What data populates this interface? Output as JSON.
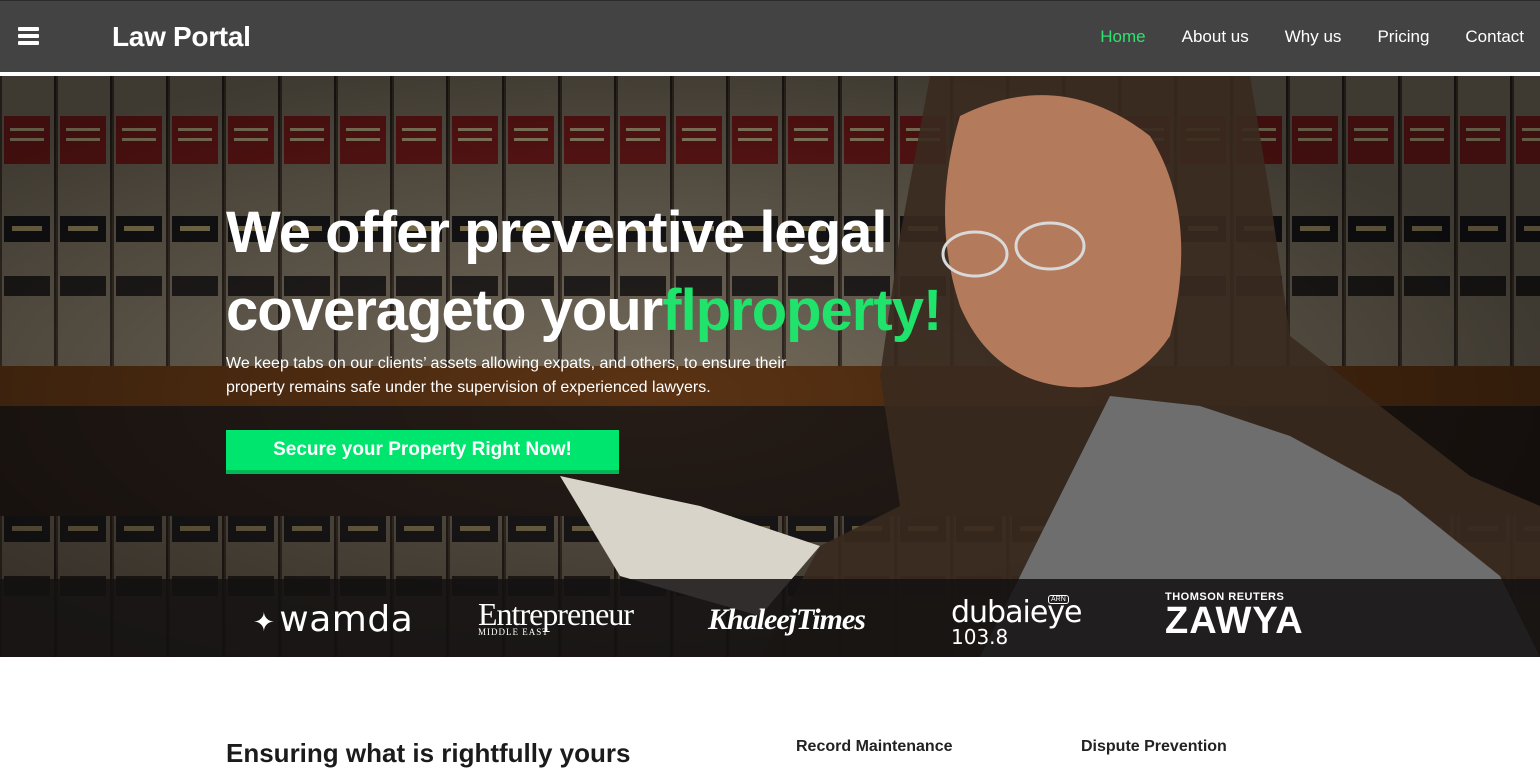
{
  "header": {
    "brand": "Law Portal",
    "nav": [
      "Home",
      "About us",
      "Why us",
      "Pricing",
      "Contact"
    ],
    "active_nav": "Home"
  },
  "hero": {
    "title_line1": "We offer preventive legal",
    "title_line2_prefix": "coverageto your",
    "title_line2_accent": "flproperty!",
    "subtitle": "We keep tabs on our clients’ assets allowing expats, and others, to ensure their property remains safe under the supervision of experienced lawyers.",
    "cta_label": "Secure your Property Right Now!"
  },
  "press": {
    "wamda": "wamda",
    "entrepreneur": "Entrepreneur",
    "entrepreneur_sub": "MIDDLE EAST",
    "khaleej_times": "KhaleejTimes",
    "dubai_eye": "dubaieye",
    "dubai_eye_freq": "103.8",
    "dubai_eye_tag": "ARN",
    "thomson_reuters": "THOMSON REUTERS",
    "zawya": "ZAWYA"
  },
  "content": {
    "section_title": "Ensuring what is rightfully yours",
    "feature1": "Record Maintenance",
    "feature2": "Dispute Prevention"
  },
  "colors": {
    "header_bg": "#434343",
    "accent_green": "#1fe36a",
    "cta_bg": "#00e56d"
  }
}
